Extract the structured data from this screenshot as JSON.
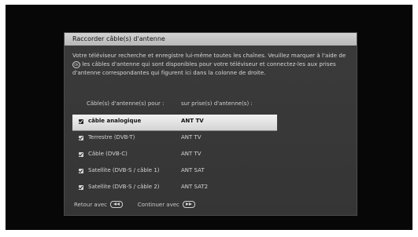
{
  "dialog": {
    "title": "Raccorder câble(s) d'antenne",
    "description_part1": "Votre téléviseur recherche et enregistre lui-même toutes les chaînes. Veuillez marquer à l'aide de",
    "ok_icon_label": "OK",
    "description_part2": "les câbles d'antenne qui sont disponibles pour votre téléviseur et connectez-les aux prises d'antenne correspondantes qui figurent ici dans la colonne de droite."
  },
  "columns": {
    "cable_header": "Câble(s) d'antenne(s) pour :",
    "port_header": "sur prise(s) d'antenne(s) :"
  },
  "cables": [
    {
      "name": "câble analogique",
      "port": "ANT TV",
      "checked": true,
      "selected": true
    },
    {
      "name": "Terrestre (DVB-T)",
      "port": "ANT TV",
      "checked": true,
      "selected": false
    },
    {
      "name": "Câble (DVB-C)",
      "port": "ANT TV",
      "checked": true,
      "selected": false
    },
    {
      "name": "Satellite (DVB-S / câble 1)",
      "port": "ANT SAT",
      "checked": true,
      "selected": false
    },
    {
      "name": "Satellite (DVB-S / câble 2)",
      "port": "ANT SAT2",
      "checked": true,
      "selected": false
    }
  ],
  "footer": {
    "back_label": "Retour avec",
    "back_icon": "rewind-button-icon",
    "continue_label": "Continuer avec",
    "continue_icon": "fast-forward-button-icon"
  }
}
